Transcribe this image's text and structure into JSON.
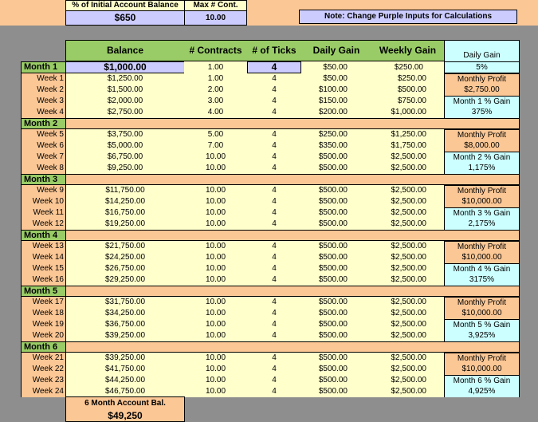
{
  "top": {
    "pct_label": "% of Initial Account Balance",
    "pct_value": "$650",
    "max_label": "Max # Cont.",
    "max_value": "10.00",
    "note": "Note: Change Purple Inputs for Calculations"
  },
  "headers": {
    "balance": "Balance",
    "contracts": "# Contracts",
    "ticks": "# of Ticks",
    "daily_gain": "Daily Gain",
    "weekly_gain": "Weekly Gain",
    "side_daily_gain_label": "Daily Gain",
    "side_daily_gain_value": "5%"
  },
  "month1_row": {
    "label": "Month 1",
    "balance": "$1,000.00",
    "contracts": "1.00",
    "ticks": "4",
    "daily": "$50.00",
    "weekly": "$250.00"
  },
  "months": [
    {
      "label": "Month 2",
      "weeks": [
        {
          "label": "Week 1",
          "balance": "$1,250.00",
          "contracts": "1.00",
          "ticks": "4",
          "daily": "$50.00",
          "weekly": "$250.00"
        },
        {
          "label": "Week 2",
          "balance": "$1,500.00",
          "contracts": "2.00",
          "ticks": "4",
          "daily": "$100.00",
          "weekly": "$500.00"
        },
        {
          "label": "Week 3",
          "balance": "$2,000.00",
          "contracts": "3.00",
          "ticks": "4",
          "daily": "$150.00",
          "weekly": "$750.00"
        },
        {
          "label": "Week 4",
          "balance": "$2,750.00",
          "contracts": "4.00",
          "ticks": "4",
          "daily": "$200.00",
          "weekly": "$1,000.00"
        }
      ],
      "side": [
        "Monthly Profit",
        "$2,750.00",
        "Month 1 % Gain",
        "375%"
      ]
    },
    {
      "label": "Month 3",
      "weeks": [
        {
          "label": "Week 5",
          "balance": "$3,750.00",
          "contracts": "5.00",
          "ticks": "4",
          "daily": "$250.00",
          "weekly": "$1,250.00"
        },
        {
          "label": "Week 6",
          "balance": "$5,000.00",
          "contracts": "7.00",
          "ticks": "4",
          "daily": "$350.00",
          "weekly": "$1,750.00"
        },
        {
          "label": "Week 7",
          "balance": "$6,750.00",
          "contracts": "10.00",
          "ticks": "4",
          "daily": "$500.00",
          "weekly": "$2,500.00"
        },
        {
          "label": "Week 8",
          "balance": "$9,250.00",
          "contracts": "10.00",
          "ticks": "4",
          "daily": "$500.00",
          "weekly": "$2,500.00"
        }
      ],
      "side": [
        "Monthly Profit",
        "$8,000.00",
        "Month 2 % Gain",
        "1,175%"
      ]
    },
    {
      "label": "Month 4",
      "weeks": [
        {
          "label": "Week 9",
          "balance": "$11,750.00",
          "contracts": "10.00",
          "ticks": "4",
          "daily": "$500.00",
          "weekly": "$2,500.00"
        },
        {
          "label": "Week 10",
          "balance": "$14,250.00",
          "contracts": "10.00",
          "ticks": "4",
          "daily": "$500.00",
          "weekly": "$2,500.00"
        },
        {
          "label": "Week 11",
          "balance": "$16,750.00",
          "contracts": "10.00",
          "ticks": "4",
          "daily": "$500.00",
          "weekly": "$2,500.00"
        },
        {
          "label": "Week 12",
          "balance": "$19,250.00",
          "contracts": "10.00",
          "ticks": "4",
          "daily": "$500.00",
          "weekly": "$2,500.00"
        }
      ],
      "side": [
        "Monthly Profit",
        "$10,000.00",
        "Month 3 % Gain",
        "2,175%"
      ]
    },
    {
      "label": "Month 5",
      "weeks": [
        {
          "label": "Week 13",
          "balance": "$21,750.00",
          "contracts": "10.00",
          "ticks": "4",
          "daily": "$500.00",
          "weekly": "$2,500.00"
        },
        {
          "label": "Week 14",
          "balance": "$24,250.00",
          "contracts": "10.00",
          "ticks": "4",
          "daily": "$500.00",
          "weekly": "$2,500.00"
        },
        {
          "label": "Week 15",
          "balance": "$26,750.00",
          "contracts": "10.00",
          "ticks": "4",
          "daily": "$500.00",
          "weekly": "$2,500.00"
        },
        {
          "label": "Week 16",
          "balance": "$29,250.00",
          "contracts": "10.00",
          "ticks": "4",
          "daily": "$500.00",
          "weekly": "$2,500.00"
        }
      ],
      "side": [
        "Monthly Profit",
        "$10,000.00",
        "Month 4 % Gain",
        "3175%"
      ]
    },
    {
      "label": "Month 6",
      "weeks": [
        {
          "label": "Week 17",
          "balance": "$31,750.00",
          "contracts": "10.00",
          "ticks": "4",
          "daily": "$500.00",
          "weekly": "$2,500.00"
        },
        {
          "label": "Week 18",
          "balance": "$34,250.00",
          "contracts": "10.00",
          "ticks": "4",
          "daily": "$500.00",
          "weekly": "$2,500.00"
        },
        {
          "label": "Week 19",
          "balance": "$36,750.00",
          "contracts": "10.00",
          "ticks": "4",
          "daily": "$500.00",
          "weekly": "$2,500.00"
        },
        {
          "label": "Week 20",
          "balance": "$39,250.00",
          "contracts": "10.00",
          "ticks": "4",
          "daily": "$500.00",
          "weekly": "$2,500.00"
        }
      ],
      "side": [
        "Monthly Profit",
        "$10,000.00",
        "Month 5 % Gain",
        "3,925%"
      ]
    },
    {
      "label": "",
      "weeks": [
        {
          "label": "Week 21",
          "balance": "$39,250.00",
          "contracts": "10.00",
          "ticks": "4",
          "daily": "$500.00",
          "weekly": "$2,500.00"
        },
        {
          "label": "Week 22",
          "balance": "$41,750.00",
          "contracts": "10.00",
          "ticks": "4",
          "daily": "$500.00",
          "weekly": "$2,500.00"
        },
        {
          "label": "Week 23",
          "balance": "$44,250.00",
          "contracts": "10.00",
          "ticks": "4",
          "daily": "$500.00",
          "weekly": "$2,500.00"
        },
        {
          "label": "Week 24",
          "balance": "$46,750.00",
          "contracts": "10.00",
          "ticks": "4",
          "daily": "$500.00",
          "weekly": "$2,500.00"
        }
      ],
      "side": [
        "Monthly Profit",
        "$10,000.00",
        "Month 6 % Gain",
        "4,925%"
      ]
    }
  ],
  "footer": {
    "label": "6 Month Account Bal.",
    "value": "$49,250"
  }
}
